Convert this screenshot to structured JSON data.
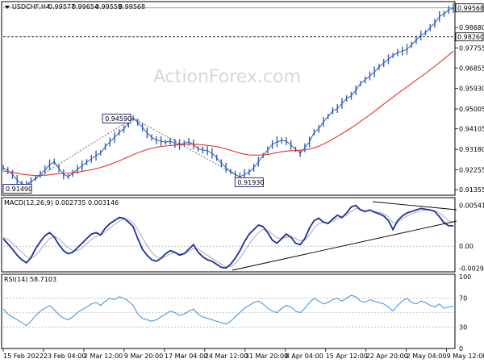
{
  "watermark": "ActionForex.com",
  "colors": {
    "price": "#2f5fb5",
    "ma": "#e8312a",
    "macd": "#1f2f9a",
    "signal": "#b9b9b9",
    "rsi": "#3b8fe0",
    "grid": "#9a9a9a",
    "box_fill": "#2c2c8c"
  },
  "chart_data": [
    {
      "type": "line",
      "title": "USDCHF,H4",
      "header_values": [
        "0.99577",
        "0.99654",
        "0.99559",
        "0.99568"
      ],
      "x_ticks": [
        "15 Feb 2022",
        "23 Feb 04:00",
        "2 Mar 12:00",
        "9 Mar 20:00",
        "17 Mar 04:00",
        "24 Mar 12:00",
        "31 Mar 20:00",
        "8 Apr 04:00",
        "15 Apr 12:00",
        "22 Apr 20:00",
        "2 May 04:00",
        "9 May 12:00"
      ],
      "y_ticks": [
        "0.98680",
        "0.97755",
        "0.96855",
        "0.95930",
        "0.95005",
        "0.94105",
        "0.93180",
        "0.92255",
        "0.91355"
      ],
      "last_price_label": "0.99568",
      "level_label": "0.98260",
      "level": 0.9826,
      "ylim": [
        0.9118,
        0.9978
      ],
      "annotations": [
        {
          "text": "0.94590",
          "value": 0.9459
        },
        {
          "text": "0.91930",
          "value": 0.9193
        },
        {
          "text": "0.91490",
          "value": 0.9149
        }
      ],
      "series": [
        {
          "values": [
            0.9235,
            0.9222,
            0.9205,
            0.9178,
            0.9162,
            0.9158,
            0.917,
            0.9188,
            0.9205,
            0.9225,
            0.9248,
            0.9262,
            0.9232,
            0.9205,
            0.9195,
            0.921,
            0.9228,
            0.9244,
            0.926,
            0.9275,
            0.929,
            0.9302,
            0.933,
            0.9352,
            0.9372,
            0.9395,
            0.941,
            0.9438,
            0.9459,
            0.944,
            0.9418,
            0.9392,
            0.9372,
            0.936,
            0.9355,
            0.935,
            0.9355,
            0.9345,
            0.934,
            0.9345,
            0.9352,
            0.934,
            0.932,
            0.9315,
            0.9312,
            0.93,
            0.928,
            0.9255,
            0.9235,
            0.9218,
            0.9205,
            0.9193,
            0.9205,
            0.9215,
            0.9235,
            0.9262,
            0.929,
            0.9315,
            0.934,
            0.9352,
            0.9358,
            0.9355,
            0.9338,
            0.9318,
            0.93,
            0.9325,
            0.9352,
            0.9395,
            0.941,
            0.9442,
            0.9466,
            0.9492,
            0.9502,
            0.9525,
            0.9548,
            0.956,
            0.9585,
            0.9615,
            0.9632,
            0.965,
            0.9668,
            0.969,
            0.9708,
            0.9725,
            0.9742,
            0.9755,
            0.9762,
            0.977,
            0.979,
            0.9812,
            0.9832,
            0.9845,
            0.9868,
            0.9888,
            0.9918,
            0.993,
            0.9948,
            0.9957
          ]
        },
        {
          "values": [
            0.922,
            0.9218,
            0.9214,
            0.921,
            0.9206,
            0.9203,
            0.9201,
            0.92,
            0.92,
            0.9201,
            0.9203,
            0.9206,
            0.9208,
            0.921,
            0.9211,
            0.9213,
            0.9215,
            0.9218,
            0.9222,
            0.9226,
            0.9231,
            0.9236,
            0.9243,
            0.925,
            0.9258,
            0.9266,
            0.9275,
            0.9284,
            0.9294,
            0.9302,
            0.931,
            0.9317,
            0.9322,
            0.9327,
            0.933,
            0.9333,
            0.9335,
            0.9337,
            0.9339,
            0.934,
            0.9341,
            0.9341,
            0.934,
            0.9338,
            0.9336,
            0.9333,
            0.933,
            0.9326,
            0.932,
            0.9314,
            0.9307,
            0.9301,
            0.9296,
            0.9293,
            0.9292,
            0.9292,
            0.9293,
            0.9295,
            0.9299,
            0.9303,
            0.9307,
            0.931,
            0.9312,
            0.9313,
            0.9314,
            0.9316,
            0.9319,
            0.9325,
            0.9332,
            0.9342,
            0.9352,
            0.9364,
            0.9376,
            0.9389,
            0.9402,
            0.9415,
            0.9429,
            0.9444,
            0.9459,
            0.9474,
            0.949,
            0.9506,
            0.9522,
            0.9538,
            0.9554,
            0.957,
            0.9585,
            0.96,
            0.9615,
            0.9631,
            0.9646,
            0.9661,
            0.9677,
            0.9693,
            0.971,
            0.9727,
            0.9744,
            0.9762
          ]
        }
      ]
    },
    {
      "type": "line",
      "title": "MACD(12,26,9) 0.002735 0.003146",
      "y_ticks": [
        "0.005419",
        "0.00",
        "-0.00293"
      ],
      "ylim": [
        -0.0034,
        0.0059
      ],
      "series": [
        {
          "values": [
            0.001,
            0.0003,
            -0.0004,
            -0.0012,
            -0.0018,
            -0.0022,
            -0.0015,
            -0.0003,
            0.0006,
            0.0014,
            0.0018,
            0.0012,
            0.0002,
            -0.0006,
            -0.001,
            -0.0008,
            -0.0002,
            0.0004,
            0.001,
            0.0016,
            0.0018,
            0.0015,
            0.0024,
            0.003,
            0.0034,
            0.0038,
            0.0037,
            0.0032,
            0.0026,
            0.001,
            -0.0004,
            -0.0012,
            -0.0018,
            -0.002,
            -0.0016,
            -0.001,
            -0.0006,
            -0.0008,
            -0.0012,
            -0.001,
            -0.0004,
            0.0002,
            -0.0008,
            -0.0014,
            -0.0018,
            -0.002,
            -0.0024,
            -0.0028,
            -0.0029,
            -0.0024,
            -0.0016,
            -0.0006,
            0.0006,
            0.0016,
            0.0022,
            0.0028,
            0.0026,
            0.0018,
            0.0008,
            0.0004,
            0.001,
            0.0016,
            0.0012,
            0.0004,
            0.0002,
            0.001,
            0.0024,
            0.0034,
            0.0037,
            0.0032,
            0.003,
            0.0036,
            0.0041,
            0.0038,
            0.0044,
            0.0052,
            0.0054,
            0.0048,
            0.0046,
            0.0048,
            0.0045,
            0.0043,
            0.004,
            0.0034,
            0.0022,
            0.0034,
            0.004,
            0.0044,
            0.0046,
            0.0048,
            0.005,
            0.0049,
            0.0048,
            0.0046,
            0.0039,
            0.0031,
            0.0027,
            0.0027
          ]
        },
        {
          "values": [
            0.0012,
            0.0009,
            0.0004,
            -0.0002,
            -0.0008,
            -0.0014,
            -0.0016,
            -0.0012,
            -0.0005,
            0.0003,
            0.001,
            0.0013,
            0.001,
            0.0004,
            -0.0002,
            -0.0006,
            -0.0006,
            -0.0002,
            0.0003,
            0.0009,
            0.0013,
            0.0015,
            0.0019,
            0.0024,
            0.0029,
            0.0033,
            0.0036,
            0.0035,
            0.0031,
            0.0022,
            0.0011,
            0.0001,
            -0.0008,
            -0.0014,
            -0.0016,
            -0.0014,
            -0.001,
            -0.0009,
            -0.001,
            -0.001,
            -0.0007,
            -0.0003,
            -0.0004,
            -0.0008,
            -0.0012,
            -0.0016,
            -0.002,
            -0.0024,
            -0.0027,
            -0.0027,
            -0.0023,
            -0.0016,
            -0.0007,
            0.0003,
            0.0011,
            0.0018,
            0.0022,
            0.0021,
            0.0016,
            0.0011,
            0.001,
            0.0012,
            0.0013,
            0.001,
            0.0007,
            0.0008,
            0.0015,
            0.0024,
            0.003,
            0.0032,
            0.0031,
            0.0033,
            0.0037,
            0.0038,
            0.0041,
            0.0046,
            0.005,
            0.0049,
            0.0047,
            0.0047,
            0.0046,
            0.0045,
            0.0043,
            0.0039,
            0.0031,
            0.0032,
            0.0036,
            0.004,
            0.0043,
            0.0045,
            0.0047,
            0.0048,
            0.0048,
            0.0047,
            0.0044,
            0.0039,
            0.0034,
            0.0031
          ]
        }
      ]
    },
    {
      "type": "line",
      "title": "RSI(14) 58.7103",
      "y_ticks": [
        "100",
        "70",
        "30",
        "0"
      ],
      "levels": [
        70,
        50,
        30
      ],
      "ylim": [
        0,
        100
      ],
      "series": [
        {
          "values": [
            55,
            48,
            44,
            40,
            36,
            32,
            38,
            46,
            52,
            56,
            60,
            54,
            47,
            42,
            40,
            44,
            50,
            54,
            58,
            62,
            64,
            60,
            66,
            70,
            68,
            72,
            70,
            66,
            60,
            48,
            42,
            40,
            38,
            40,
            44,
            48,
            52,
            50,
            46,
            48,
            52,
            55,
            48,
            44,
            42,
            40,
            38,
            36,
            34,
            38,
            44,
            50,
            56,
            60,
            64,
            66,
            62,
            56,
            52,
            50,
            56,
            60,
            58,
            52,
            50,
            56,
            64,
            70,
            66,
            62,
            64,
            68,
            70,
            66,
            70,
            74,
            72,
            66,
            64,
            68,
            66,
            64,
            62,
            58,
            52,
            60,
            66,
            70,
            64,
            62,
            66,
            64,
            60,
            58,
            62,
            56,
            58,
            59
          ]
        }
      ]
    }
  ]
}
